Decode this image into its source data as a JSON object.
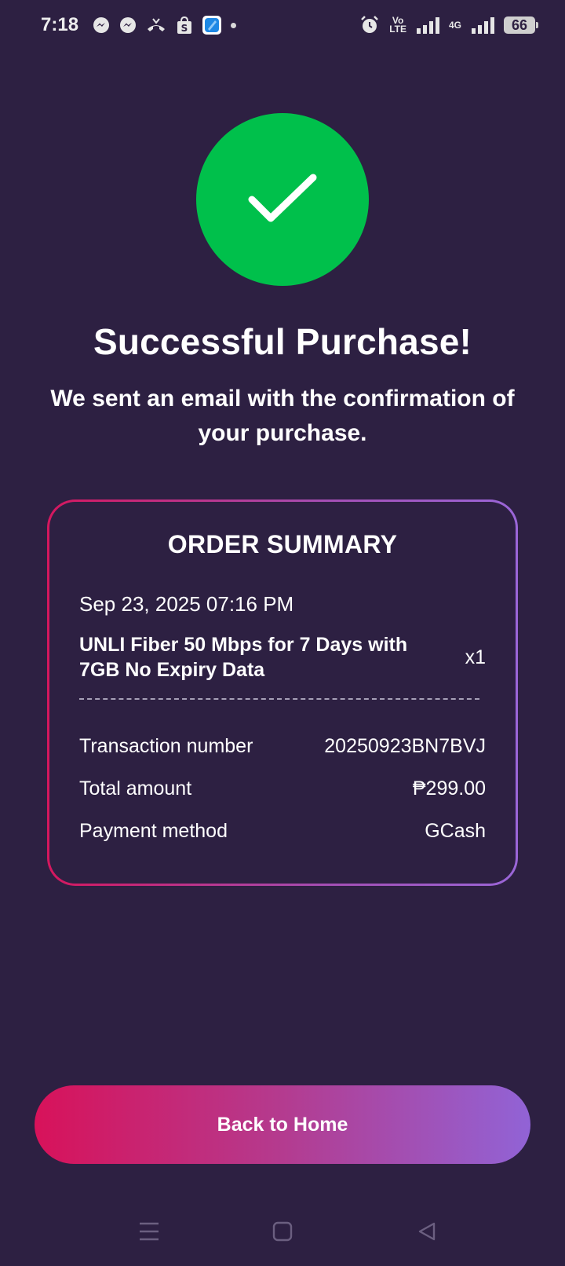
{
  "status_bar": {
    "time": "7:18",
    "volte_top": "Vo",
    "volte_bottom": "LTE",
    "network_type": "4G",
    "battery": "66",
    "icons": [
      "messenger-icon",
      "messenger-icon",
      "missed-call-icon",
      "shopee-icon",
      "app-icon",
      "notification-dot",
      "alarm-icon",
      "volte-icon",
      "signal-icon",
      "data-4g-icon",
      "signal-icon",
      "battery-icon"
    ]
  },
  "success": {
    "icon": "checkmark-icon",
    "color": "#00c04b",
    "title": "Successful Purchase!",
    "subtitle": "We sent an email with the confirmation of your purchase."
  },
  "order_summary": {
    "title": "ORDER SUMMARY",
    "date": "Sep 23, 2025 07:16 PM",
    "product": {
      "name": "UNLI Fiber 50 Mbps for 7 Days with 7GB No Expiry Data",
      "quantity": "x1"
    },
    "details": [
      {
        "label": "Transaction number",
        "value": "20250923BN7BVJ"
      },
      {
        "label": "Total amount",
        "value": "₱299.00"
      },
      {
        "label": "Payment method",
        "value": "GCash"
      }
    ],
    "border_gradient": [
      "#d5175e",
      "#9a66d8"
    ]
  },
  "actions": {
    "back_to_home": "Back to Home"
  },
  "nav_bar": {
    "icons": [
      "recent-apps-icon",
      "home-icon",
      "back-icon"
    ]
  },
  "colors": {
    "background": "#2d2042"
  }
}
